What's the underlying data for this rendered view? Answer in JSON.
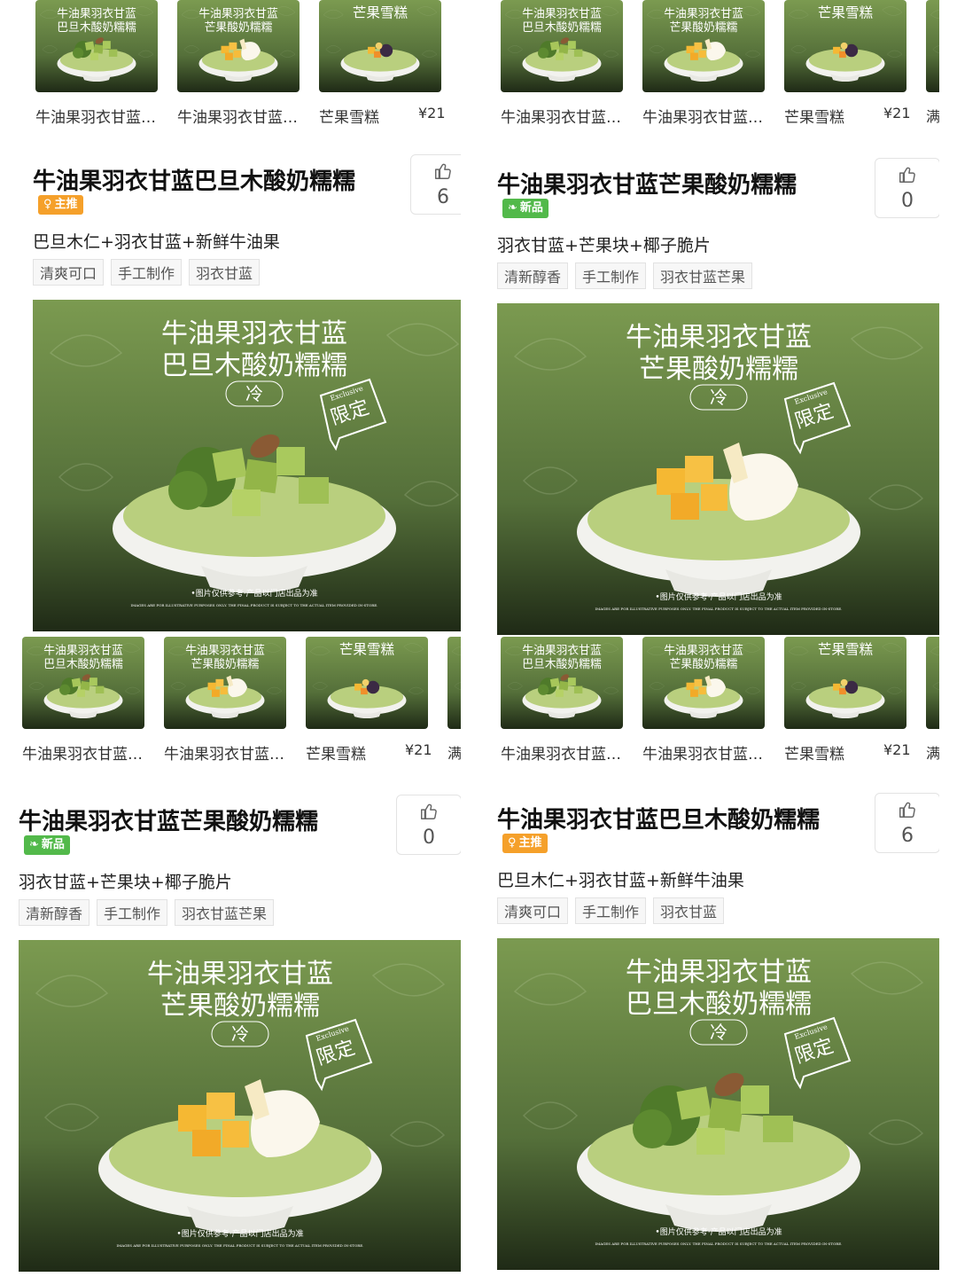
{
  "colors": {
    "brand_green": "#52b94a",
    "badge_orange": "#f5a02a",
    "hero_green": "#6d8a45"
  },
  "thumb_labels": [
    "牛油果羽衣甘蓝…",
    "牛油果羽衣甘蓝…",
    "芒果雪糕"
  ],
  "thumb_price": "¥21",
  "thumb_deal_cut": "满分",
  "thumb_deal_cut_tl": "满",
  "products": {
    "almond": {
      "title": "牛油果羽衣甘蓝巴旦木酸奶糯糯",
      "badge": "主推",
      "badge_icon": "medal-icon",
      "likes": "6",
      "desc": "巴旦木仁+羽衣甘蓝+新鲜牛油果",
      "tags": [
        "清爽可口",
        "手工制作",
        "羽衣甘蓝"
      ],
      "hero_line1": "牛油果羽衣甘蓝",
      "hero_line2": "巴旦木酸奶糯糯"
    },
    "mango": {
      "title": "牛油果羽衣甘蓝芒果酸奶糯糯",
      "badge": "新品",
      "badge_icon": "leaf-icon",
      "likes": "0",
      "desc": "羽衣甘蓝+芒果块+椰子脆片",
      "tags": [
        "清新醇香",
        "手工制作",
        "羽衣甘蓝芒果"
      ],
      "hero_line1": "牛油果羽衣甘蓝",
      "hero_line2": "芒果酸奶糯糯"
    }
  },
  "hero_cold": "冷",
  "hero_limited": "限定",
  "hero_exclusive": "Exclusive",
  "hero_disclaimer": "•图片仅供参考·产品以门店出品为准",
  "hero_disclaimer_en": "IMAGES ARE FOR ILLUSTRATIVE PURPOSES ONLY. THE FINAL PRODUCT IS SUBJECT TO THE ACTUAL ITEM PROVIDED IN-STORE.",
  "thumb_titles": {
    "almond": [
      "牛油果羽衣甘蓝",
      "巴旦木酸奶糯糯"
    ],
    "mango": [
      "牛油果羽衣甘蓝",
      "芒果酸奶糯糯"
    ],
    "sorbet": [
      "芒果雪糕"
    ]
  }
}
